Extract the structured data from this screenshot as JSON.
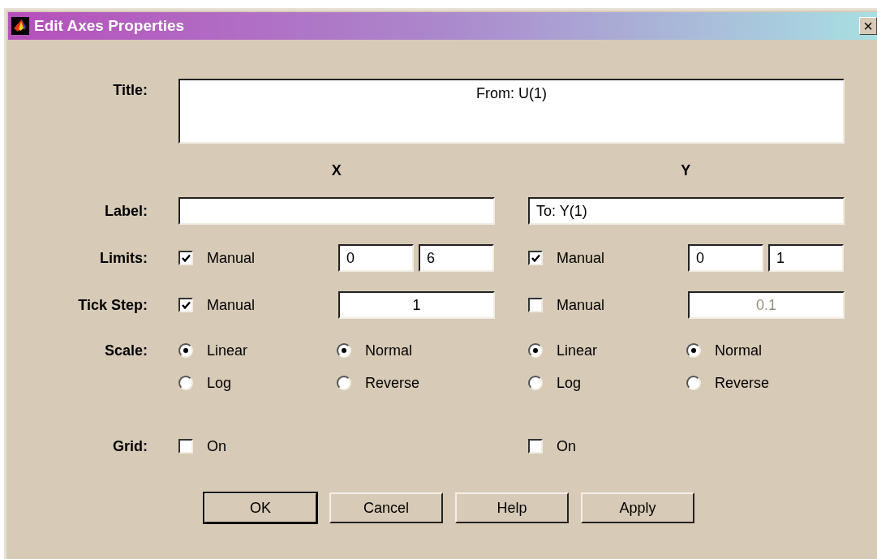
{
  "window": {
    "title": "Edit Axes Properties",
    "close": "×"
  },
  "row_labels": {
    "title": "Title:",
    "label": "Label:",
    "limits": "Limits:",
    "tick_step": "Tick Step:",
    "scale": "Scale:",
    "grid": "Grid:"
  },
  "title_field": {
    "value": "From: U(1)"
  },
  "axes": [
    {
      "heading": "X",
      "limits": {
        "manual_label": "Manual",
        "manual": true,
        "min": "0",
        "max": "6"
      },
      "tick_step": {
        "manual_label": "Manual",
        "manual": true,
        "value": "1"
      },
      "scale_options": [
        {
          "label": "Linear",
          "selected": true
        },
        {
          "label": "Log",
          "selected": false
        }
      ],
      "direction_options": [
        {
          "label": "Normal",
          "selected": true
        },
        {
          "label": "Reverse",
          "selected": false
        }
      ],
      "grid": {
        "label": "On",
        "checked": false
      }
    },
    {
      "heading": "Y",
      "label_field": {
        "value": "To: Y(1)"
      },
      "limits": {
        "manual_label": "Manual",
        "manual": true,
        "min": "0",
        "max": "1"
      },
      "tick_step": {
        "manual_label": "Manual",
        "manual": false,
        "value": "0.1"
      },
      "scale_options": [
        {
          "label": "Linear",
          "selected": true
        },
        {
          "label": "Log",
          "selected": false
        }
      ],
      "direction_options": [
        {
          "label": "Normal",
          "selected": true
        },
        {
          "label": "Reverse",
          "selected": false
        }
      ],
      "grid": {
        "label": "On",
        "checked": false
      }
    }
  ],
  "buttons": [
    {
      "label": "OK",
      "default": true
    },
    {
      "label": "Cancel",
      "default": false
    },
    {
      "label": "Help",
      "default": false
    },
    {
      "label": "Apply",
      "default": false
    }
  ]
}
